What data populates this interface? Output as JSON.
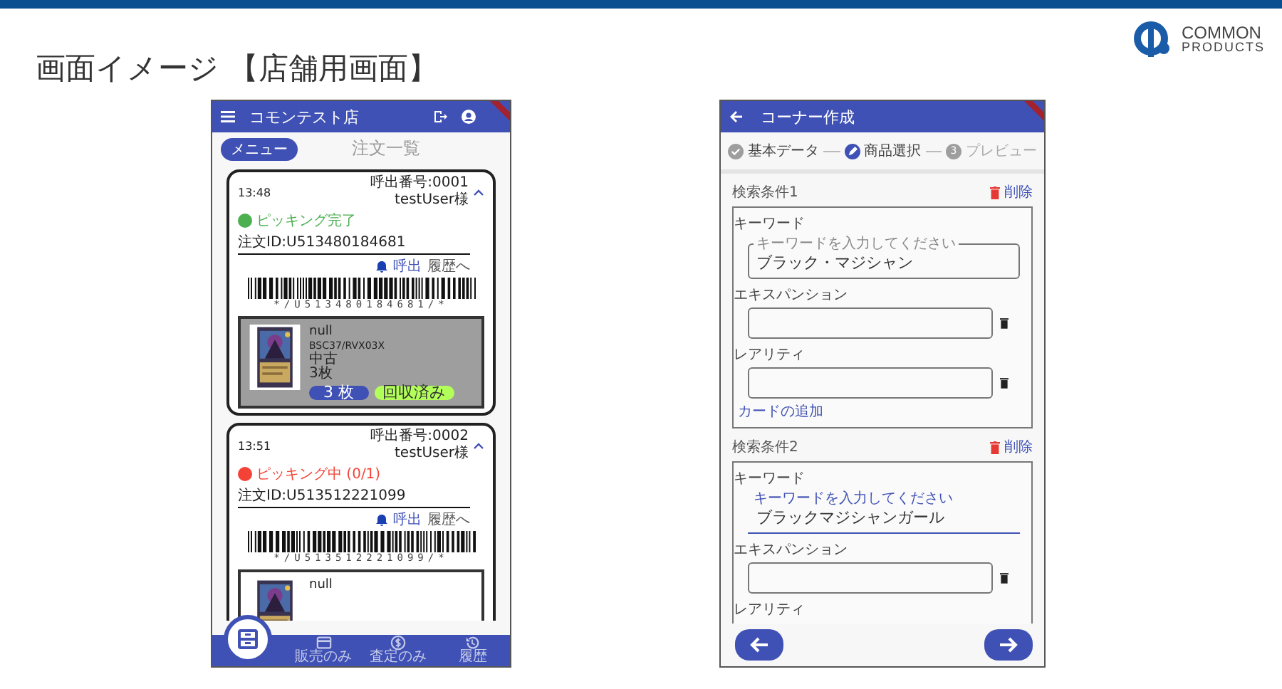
{
  "slide": {
    "title": "画面イメージ 【店舗用画面】",
    "logo": [
      "COMMON",
      "PRODUCTS"
    ]
  },
  "store_screen": {
    "app_bar": {
      "title": "コモンテスト店"
    },
    "menu_button": "メニュー",
    "page_title": "注文一覧",
    "orders": [
      {
        "time": "13:48",
        "call_number": "呼出番号:0001",
        "customer": "testUser様",
        "expanded": true,
        "status": {
          "label": "ピッキング完了",
          "color": "#4caf50"
        },
        "order_id": "注文ID:U513480184681",
        "call_link": "呼出",
        "history_link": "履歴へ",
        "barcode_text": "*/U513480184681/*",
        "item": {
          "collected": true,
          "name": "null",
          "code": "BSC37/RVX03X",
          "condition": "中古",
          "quantity": "3枚",
          "count_badge": "3 枚",
          "collected_badge": "回収済み"
        }
      },
      {
        "time": "13:51",
        "call_number": "呼出番号:0002",
        "customer": "testUser様",
        "expanded": true,
        "status": {
          "label": "ピッキング中 (0/1)",
          "color": "#f44336"
        },
        "order_id": "注文ID:U513512221099",
        "call_link": "呼出",
        "history_link": "履歴へ",
        "barcode_text": "*/U513512221099/*",
        "item": {
          "collected": false,
          "name": "null"
        }
      }
    ],
    "bottom_nav": [
      {
        "kind": "card",
        "label": "販売のみ"
      },
      {
        "kind": "coin",
        "label": "査定のみ"
      },
      {
        "kind": "history",
        "label": "履歴"
      }
    ]
  },
  "corner_screen": {
    "app_bar": {
      "title": "コーナー作成"
    },
    "steps": [
      {
        "kind": "done",
        "label": "基本データ"
      },
      {
        "kind": "active",
        "label": "商品選択"
      },
      {
        "kind": "pending",
        "number": "3",
        "label": "プレビュー"
      }
    ],
    "conditions": [
      {
        "title": "検索条件1",
        "delete_label": "削除",
        "keyword": {
          "label": "キーワード",
          "floating_label": "キーワードを入力してください",
          "value": "ブラック・マジシャン",
          "focused": false
        },
        "fields": [
          {
            "label": "エキスパンション",
            "has_input": true
          },
          {
            "label": "レアリティ",
            "has_input": true
          }
        ],
        "add_link": "カードの追加"
      },
      {
        "title": "検索条件2",
        "delete_label": "削除",
        "keyword": {
          "label": "キーワード",
          "floating_label": "キーワードを入力してください",
          "value": "ブラックマジシャンガール",
          "focused": true
        },
        "fields": [
          {
            "label": "エキスパンション",
            "has_input": true
          },
          {
            "label": "レアリティ",
            "has_input": false
          }
        ]
      }
    ]
  }
}
